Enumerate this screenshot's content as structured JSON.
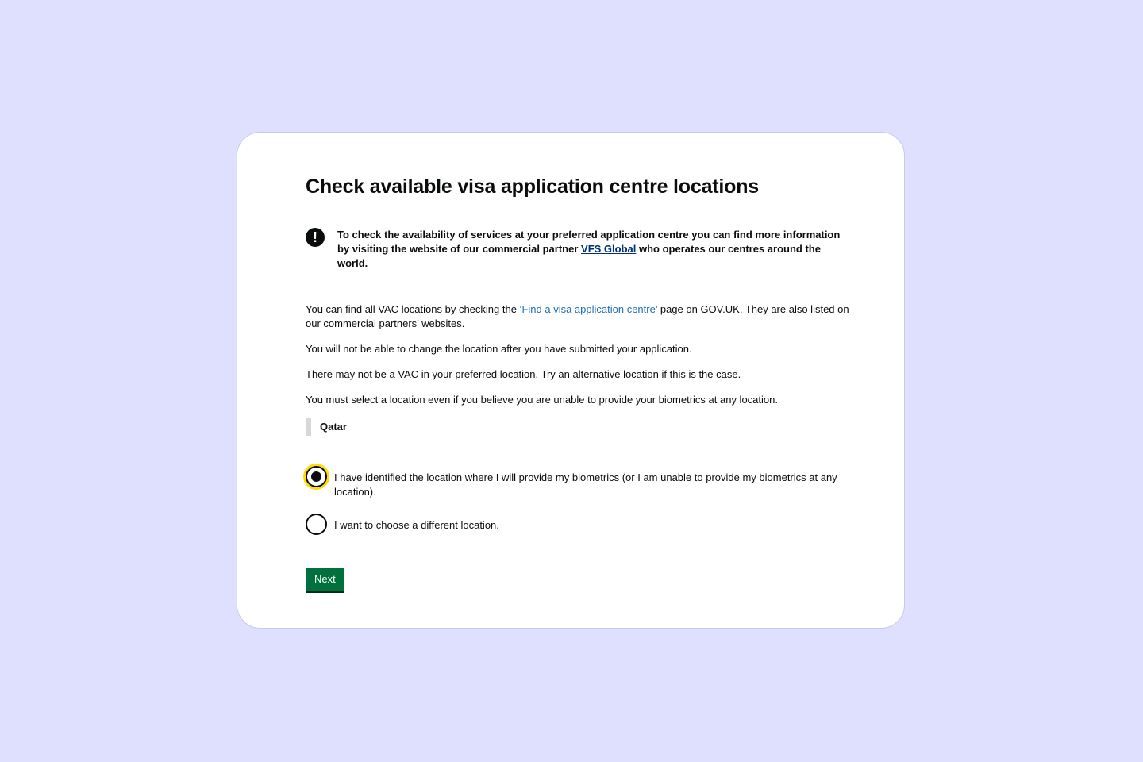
{
  "page": {
    "title": "Check available visa application centre locations"
  },
  "warning": {
    "icon": "warning-icon",
    "text_before": "To check the availability of services at your preferred application centre you can find more information by visiting the website of our commercial partner ",
    "link_text": "VFS Global",
    "text_after": " who operates our centres around the world."
  },
  "body": {
    "p1_before": "You can find all VAC locations by checking the ",
    "p1_link": "‘Find a visa application centre’",
    "p1_after": " page on GOV.UK. They are also listed on our commercial partners’ websites.",
    "p2": "You will not be able to change the location after you have submitted your application.",
    "p3": "There may not be a VAC in your preferred location. Try an alternative location if this is the case.",
    "p4": "You must select a location even if you believe you are unable to provide your biometrics at any location."
  },
  "location": {
    "country": "Qatar"
  },
  "radios": [
    {
      "label": "I have identified the location where I will provide my biometrics (or I am unable to provide my biometrics at any location).",
      "checked": true
    },
    {
      "label": "I want to choose a different location.",
      "checked": false
    }
  ],
  "actions": {
    "next_label": "Next"
  },
  "colors": {
    "background": "#dfdffe",
    "button": "#00703c",
    "link": "#1d70b8",
    "focus": "#ffdd00"
  }
}
